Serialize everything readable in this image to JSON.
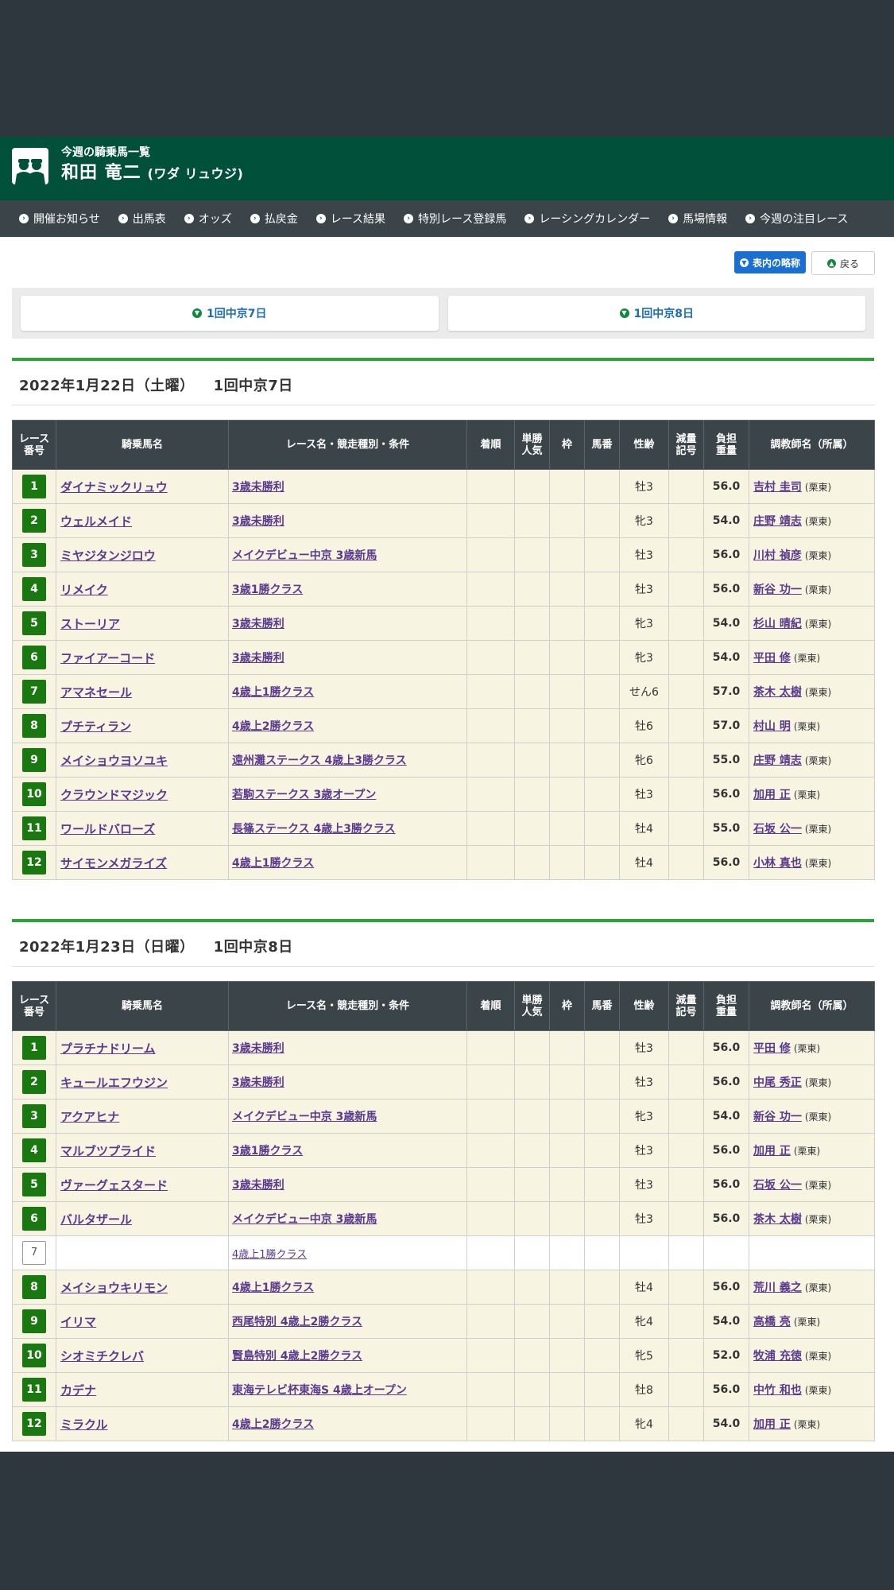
{
  "header": {
    "subtitle": "今週の騎乗馬一覧",
    "name": "和田 竜二",
    "kana": "(ワダ リュウジ)"
  },
  "nav": [
    "開催お知らせ",
    "出馬表",
    "オッズ",
    "払戻金",
    "レース結果",
    "特別レース登録馬",
    "レーシングカレンダー",
    "馬場情報",
    "今週の注目レース"
  ],
  "buttons": {
    "legend": "表内の略称",
    "back": "戻る"
  },
  "day_tabs": [
    "1回中京7日",
    "1回中京8日"
  ],
  "columns": [
    "レース番号",
    "騎乗馬名",
    "レース名・競走種別・条件",
    "着順",
    "単勝人気",
    "枠",
    "馬番",
    "性齢",
    "減量記号",
    "負担重量",
    "調教師名（所属）"
  ],
  "days": [
    {
      "date": "2022年1月22日（土曜）",
      "place": "1回中京7日",
      "rows": [
        {
          "no": "1",
          "horse": "ダイナミックリュウ",
          "race": "3歳未勝利",
          "sexage": "牡3",
          "weight": "56.0",
          "trainer": "吉村 圭司",
          "aff": "(栗東)"
        },
        {
          "no": "2",
          "horse": "ウェルメイド",
          "race": "3歳未勝利",
          "sexage": "牝3",
          "weight": "54.0",
          "trainer": "庄野 靖志",
          "aff": "(栗東)"
        },
        {
          "no": "3",
          "horse": "ミヤジタンジロウ",
          "race": "メイクデビュー中京 3歳新馬",
          "sexage": "牡3",
          "weight": "56.0",
          "trainer": "川村 禎彦",
          "aff": "(栗東)"
        },
        {
          "no": "4",
          "horse": "リメイク",
          "race": "3歳1勝クラス",
          "sexage": "牡3",
          "weight": "56.0",
          "trainer": "新谷 功一",
          "aff": "(栗東)"
        },
        {
          "no": "5",
          "horse": "ストーリア",
          "race": "3歳未勝利",
          "sexage": "牝3",
          "weight": "54.0",
          "trainer": "杉山 晴紀",
          "aff": "(栗東)"
        },
        {
          "no": "6",
          "horse": "ファイアーコード",
          "race": "3歳未勝利",
          "sexage": "牝3",
          "weight": "54.0",
          "trainer": "平田 修",
          "aff": "(栗東)"
        },
        {
          "no": "7",
          "horse": "アマネセール",
          "race": "4歳上1勝クラス",
          "sexage": "せん6",
          "weight": "57.0",
          "trainer": "茶木 太樹",
          "aff": "(栗東)"
        },
        {
          "no": "8",
          "horse": "プチティラン",
          "race": "4歳上2勝クラス",
          "sexage": "牡6",
          "weight": "57.0",
          "trainer": "村山 明",
          "aff": "(栗東)"
        },
        {
          "no": "9",
          "horse": "メイショウヨソユキ",
          "race": "遠州灘ステークス 4歳上3勝クラス",
          "sexage": "牝6",
          "weight": "55.0",
          "trainer": "庄野 靖志",
          "aff": "(栗東)"
        },
        {
          "no": "10",
          "horse": "クラウンドマジック",
          "race": "若駒ステークス 3歳オープン",
          "sexage": "牡3",
          "weight": "56.0",
          "trainer": "加用 正",
          "aff": "(栗東)"
        },
        {
          "no": "11",
          "horse": "ワールドバローズ",
          "race": "長篠ステークス 4歳上3勝クラス",
          "sexage": "牡4",
          "weight": "55.0",
          "trainer": "石坂 公一",
          "aff": "(栗東)"
        },
        {
          "no": "12",
          "horse": "サイモンメガライズ",
          "race": "4歳上1勝クラス",
          "sexage": "牡4",
          "weight": "56.0",
          "trainer": "小林 真也",
          "aff": "(栗東)"
        }
      ]
    },
    {
      "date": "2022年1月23日（日曜）",
      "place": "1回中京8日",
      "rows": [
        {
          "no": "1",
          "horse": "プラチナドリーム",
          "race": "3歳未勝利",
          "sexage": "牡3",
          "weight": "56.0",
          "trainer": "平田 修",
          "aff": "(栗東)"
        },
        {
          "no": "2",
          "horse": "キュールエフウジン",
          "race": "3歳未勝利",
          "sexage": "牡3",
          "weight": "56.0",
          "trainer": "中尾 秀正",
          "aff": "(栗東)"
        },
        {
          "no": "3",
          "horse": "アクアヒナ",
          "race": "メイクデビュー中京 3歳新馬",
          "sexage": "牝3",
          "weight": "54.0",
          "trainer": "新谷 功一",
          "aff": "(栗東)"
        },
        {
          "no": "4",
          "horse": "マルブツプライド",
          "race": "3歳1勝クラス",
          "sexage": "牡3",
          "weight": "56.0",
          "trainer": "加用 正",
          "aff": "(栗東)"
        },
        {
          "no": "5",
          "horse": "ヴァーグェスタード",
          "race": "3歳未勝利",
          "sexage": "牡3",
          "weight": "56.0",
          "trainer": "石坂 公一",
          "aff": "(栗東)"
        },
        {
          "no": "6",
          "horse": "バルタザール",
          "race": "メイクデビュー中京 3歳新馬",
          "sexage": "牡3",
          "weight": "56.0",
          "trainer": "茶木 太樹",
          "aff": "(栗東)"
        },
        {
          "no": "7",
          "horse": "",
          "race": "4歳上1勝クラス",
          "sexage": "",
          "weight": "",
          "trainer": "",
          "aff": "",
          "empty": true
        },
        {
          "no": "8",
          "horse": "メイショウキリモン",
          "race": "4歳上1勝クラス",
          "sexage": "牡4",
          "weight": "56.0",
          "trainer": "荒川 義之",
          "aff": "(栗東)"
        },
        {
          "no": "9",
          "horse": "イリマ",
          "race": "西尾特別 4歳上2勝クラス",
          "sexage": "牝4",
          "weight": "54.0",
          "trainer": "高橋 亮",
          "aff": "(栗東)"
        },
        {
          "no": "10",
          "horse": "シオミチクレバ",
          "race": "賢島特別 4歳上2勝クラス",
          "sexage": "牝5",
          "weight": "52.0",
          "trainer": "牧浦 充徳",
          "aff": "(栗東)"
        },
        {
          "no": "11",
          "horse": "カデナ",
          "race": "東海テレビ杯東海S 4歳上オープン",
          "sexage": "牡8",
          "weight": "56.0",
          "trainer": "中竹 和也",
          "aff": "(栗東)"
        },
        {
          "no": "12",
          "horse": "ミラクル",
          "race": "4歳上2勝クラス",
          "sexage": "牝4",
          "weight": "54.0",
          "trainer": "加用 正",
          "aff": "(栗東)"
        }
      ]
    }
  ]
}
